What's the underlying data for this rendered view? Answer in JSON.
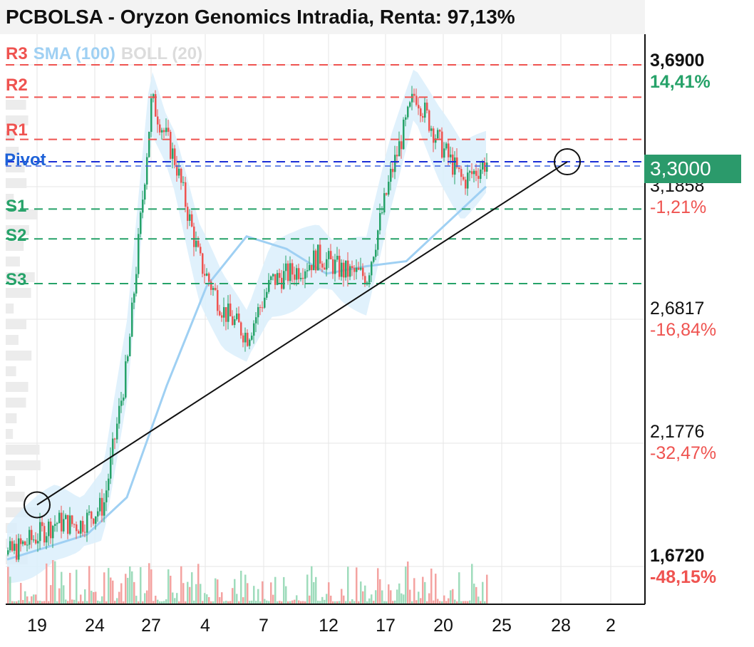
{
  "title": "PCBOLSA - Oryzon Genomics Intradia, Renta: 97,13%",
  "legend": {
    "r3": "R3",
    "sma": "SMA (100)",
    "boll": "BOLL (20)"
  },
  "levels": {
    "r2": "R2",
    "r1": "R1",
    "pivot": "Pivot",
    "s1": "S1",
    "s2": "S2",
    "s3": "S3"
  },
  "last_price": "3,3000",
  "colors": {
    "up": "#26a269",
    "down": "#ef5350",
    "sma": "#9fd0f3",
    "boll_band": "#dbeefb",
    "pivot": "#1e62d8"
  },
  "y_axis": [
    {
      "value": "3,6900",
      "pct": "14,41%"
    },
    {
      "value": "3,1858",
      "pct": "-1,21%"
    },
    {
      "value": "2,6817",
      "pct": "-16,84%"
    },
    {
      "value": "2,1776",
      "pct": "-32,47%"
    },
    {
      "value": "1,6720",
      "pct": "-48,15%"
    }
  ],
  "x_axis": [
    "19",
    "24",
    "27",
    "4",
    "7",
    "12",
    "17",
    "20",
    "25",
    "28",
    "2"
  ],
  "chart_data": {
    "type": "line",
    "title": "PCBOLSA - Oryzon Genomics Intradia, Renta: 97,13%",
    "x": [
      "19",
      "24",
      "27",
      "4",
      "7",
      "12",
      "17",
      "20",
      "25",
      "28",
      "2"
    ],
    "ylim": [
      1.672,
      3.69
    ],
    "y_ticks": [
      3.69,
      3.1858,
      2.6817,
      2.1776,
      1.672
    ],
    "levels": {
      "R3": 3.69,
      "R2": 3.56,
      "R1": 3.39,
      "Pivot": 3.3,
      "S1": 3.11,
      "S2": 2.99,
      "S3": 2.81
    },
    "series": [
      {
        "name": "SMA (100)",
        "values": [
          1.7,
          1.75,
          1.8,
          1.95,
          2.4,
          2.8,
          3.0,
          2.95,
          2.85,
          2.88,
          2.9,
          3.05,
          3.2
        ]
      },
      {
        "name": "BOLL (20)",
        "values": [
          1.75,
          1.8,
          1.95,
          2.4,
          3.3,
          3.2,
          2.95,
          2.85,
          2.9,
          2.92,
          2.95,
          3.4,
          3.25
        ]
      }
    ],
    "price_path": [
      1.72,
      1.78,
      1.85,
      1.84,
      1.92,
      2.5,
      3.55,
      3.3,
      2.9,
      2.7,
      2.6,
      2.82,
      2.86,
      2.92,
      2.86,
      2.84,
      3.25,
      3.58,
      3.38,
      3.22,
      3.3
    ],
    "trendline": {
      "from": {
        "x": "19",
        "y": 1.92
      },
      "to": {
        "x": "28",
        "y": 3.3
      }
    }
  }
}
